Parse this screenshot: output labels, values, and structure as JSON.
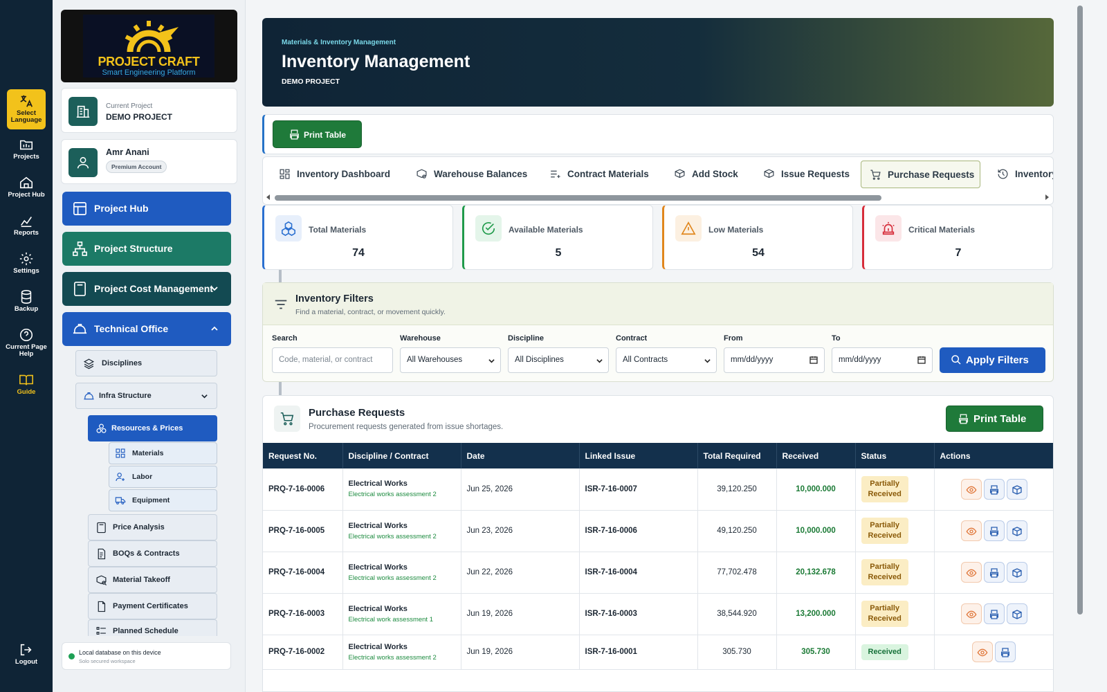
{
  "rail": {
    "language": "Select Language",
    "projects": "Projects",
    "project_hub": "Project Hub",
    "reports": "Reports",
    "settings": "Settings",
    "backup": "Backup",
    "help": "Current Page Help",
    "guide": "Guide",
    "logout": "Logout"
  },
  "brand": {
    "title": "PROJECT CRAFT",
    "subtitle": "Smart Engineering Platform"
  },
  "project_card": {
    "label": "Current Project",
    "value": "DEMO PROJECT"
  },
  "user_card": {
    "name": "Amr Anani",
    "badge": "Premium Account"
  },
  "nav": {
    "project_hub": "Project Hub",
    "project_structure": "Project Structure",
    "cost_management": "Project Cost Management",
    "technical_office": "Technical Office",
    "disciplines": "Disciplines",
    "infra": "Infra Structure",
    "resources": "Resources & Prices",
    "materials": "Materials",
    "labor": "Labor",
    "equipment": "Equipment",
    "price_analysis": "Price Analysis",
    "boqs": "BOQs & Contracts",
    "takeoff": "Material Takeoff",
    "payment": "Payment Certificates",
    "schedule": "Planned Schedule"
  },
  "db_status": {
    "title": "Local database on this device",
    "subtitle": "Solo secured workspace"
  },
  "hero": {
    "kicker": "Materials & Inventory Management",
    "title": "Inventory Management",
    "project": "DEMO PROJECT"
  },
  "print_label": "Print Table",
  "tabs": [
    "Inventory Dashboard",
    "Warehouse Balances",
    "Contract Materials",
    "Add Stock",
    "Issue Requests",
    "Purchase Requests",
    "Inventory"
  ],
  "stats": [
    {
      "label": "Total Materials",
      "value": "74",
      "color": "#2a6fd0"
    },
    {
      "label": "Available Materials",
      "value": "5",
      "color": "#1f9a4a"
    },
    {
      "label": "Low Materials",
      "value": "54",
      "color": "#e0861c"
    },
    {
      "label": "Critical Materials",
      "value": "7",
      "color": "#d62d3a"
    }
  ],
  "filters": {
    "title": "Inventory Filters",
    "subtitle": "Find a material, contract, or movement quickly.",
    "search_label": "Search",
    "search_placeholder": "Code, material, or contract",
    "warehouse_label": "Warehouse",
    "warehouse_value": "All Warehouses",
    "discipline_label": "Discipline",
    "discipline_value": "All Disciplines",
    "contract_label": "Contract",
    "contract_value": "All Contracts",
    "from_label": "From",
    "to_label": "To",
    "date_placeholder": "mm/dd/yyyy",
    "apply": "Apply Filters"
  },
  "table": {
    "title": "Purchase Requests",
    "subtitle": "Procurement requests generated from issue shortages.",
    "print": "Print Table",
    "headers": [
      "Request No.",
      "Discipline / Contract",
      "Date",
      "Linked Issue",
      "Total Required",
      "Received",
      "Status",
      "Actions"
    ],
    "rows": [
      {
        "no": "PRQ-7-16-0006",
        "disc": "Electrical Works",
        "contract": "Electrical works assessment 2",
        "date": "Jun 25, 2026",
        "issue": "ISR-7-16-0007",
        "total": "39,120.250",
        "received": "10,000.000",
        "status_l1": "Partially",
        "status_l2": "Received"
      },
      {
        "no": "PRQ-7-16-0005",
        "disc": "Electrical Works",
        "contract": "Electrical works assessment 2",
        "date": "Jun 23, 2026",
        "issue": "ISR-7-16-0006",
        "total": "49,120.250",
        "received": "10,000.000",
        "status_l1": "Partially",
        "status_l2": "Received"
      },
      {
        "no": "PRQ-7-16-0004",
        "disc": "Electrical Works",
        "contract": "Electrical works assessment 2",
        "date": "Jun 22, 2026",
        "issue": "ISR-7-16-0004",
        "total": "77,702.478",
        "received": "20,132.678",
        "status_l1": "Partially",
        "status_l2": "Received"
      },
      {
        "no": "PRQ-7-16-0003",
        "disc": "Electrical Works",
        "contract": "Electrical work assessment 1",
        "date": "Jun 19, 2026",
        "issue": "ISR-7-16-0003",
        "total": "38,544.920",
        "received": "13,200.000",
        "status_l1": "Partially",
        "status_l2": "Received"
      },
      {
        "no": "PRQ-7-16-0002",
        "disc": "Electrical Works",
        "contract": "Electrical works assessment 2",
        "date": "Jun 19, 2026",
        "issue": "ISR-7-16-0001",
        "total": "305.730",
        "received": "305.730",
        "status_l1": "Received",
        "status_l2": ""
      }
    ]
  }
}
